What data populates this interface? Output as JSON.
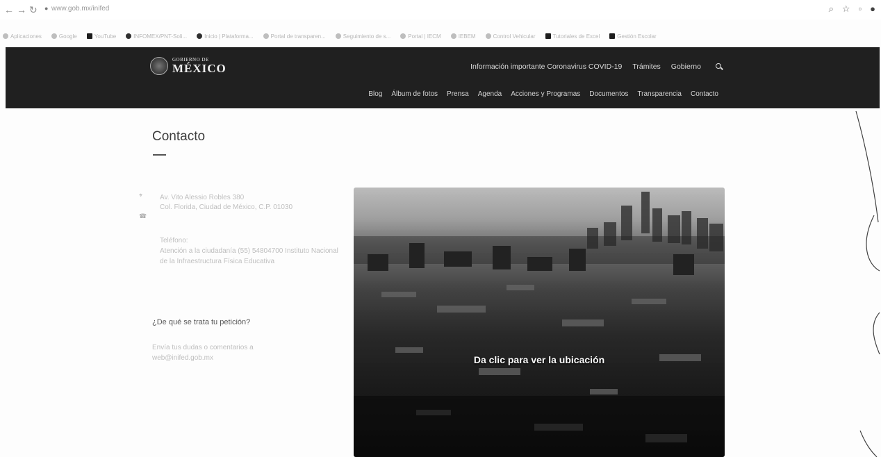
{
  "browser": {
    "url": "www.gob.mx/inifed",
    "bookmarks": [
      "Aplicaciones",
      "Google",
      "YouTube",
      "INFOMEX/PNT-Soli...",
      "Inicio | Plataforma...",
      "Portal de transparen...",
      "Seguimiento de s...",
      "Portal | IECM",
      "IEBEM",
      "Control Vehicular",
      "Tutoriales de Excel",
      "Gestión Escolar"
    ]
  },
  "header": {
    "logo_small": "GOBIERNO DE",
    "logo_big": "MÉXICO",
    "top_nav": [
      "Información importante Coronavirus COVID-19",
      "Trámites",
      "Gobierno"
    ],
    "sub_nav": [
      "Blog",
      "Álbum de fotos",
      "Prensa",
      "Agenda",
      "Acciones y Programas",
      "Documentos",
      "Transparencia",
      "Contacto"
    ]
  },
  "content": {
    "title": "Contacto",
    "address_line1": "Av. Vito Alessio Robles 380",
    "address_line2": "Col. Florida, Ciudad de México, C.P. 01030",
    "phone_label": "Teléfono:",
    "phone_text": "Atención a la ciudadanía (55) 54804700 Instituto Nacional de la Infraestructura Física Educativa",
    "question": "¿De qué se trata tu petición?",
    "send_text": "Envía tus dudas o comentarios a web@inifed.gob.mx",
    "map_caption": "Da clic para ver la ubicación"
  }
}
